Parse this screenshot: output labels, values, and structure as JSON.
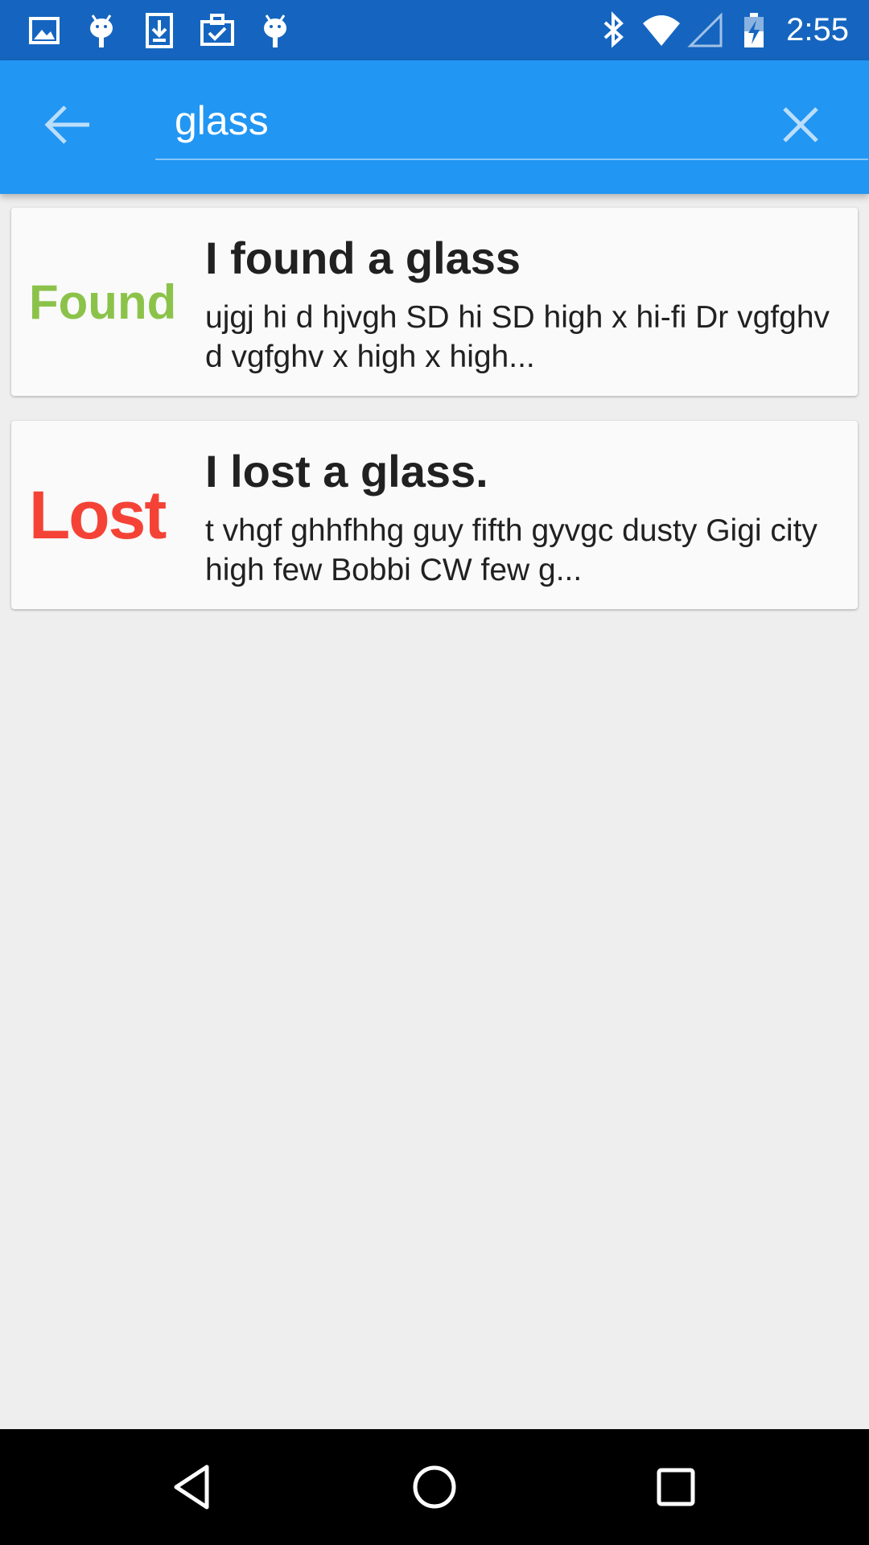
{
  "status_bar": {
    "time": "2:55",
    "left_icons": [
      "image-icon",
      "android-icon",
      "download-icon",
      "clipboard-check-icon",
      "android-icon"
    ],
    "right_icons": [
      "bluetooth-icon",
      "wifi-icon",
      "signal-icon",
      "battery-charging-icon"
    ]
  },
  "app_bar": {
    "back_icon": "arrow-back-icon",
    "search_value": "glass",
    "clear_icon": "close-icon",
    "color": "#2196f3"
  },
  "results": [
    {
      "status": "Found",
      "status_color": "#8bc34a",
      "title": "I found a glass",
      "snippet": "ujgj hi d hjvgh SD hi SD high x hi-fi Dr vgfghv d vgfghv x high x high..."
    },
    {
      "status": "Lost",
      "status_color": "#f44336",
      "title": "I lost a glass.",
      "snippet": "t vhgf ghhfhhg guy fifth gyvgc dusty Gigi city high few Bobbi CW few g..."
    }
  ],
  "nav_bar": {
    "buttons": [
      "back-triangle-icon",
      "home-circle-icon",
      "recents-square-icon"
    ]
  }
}
